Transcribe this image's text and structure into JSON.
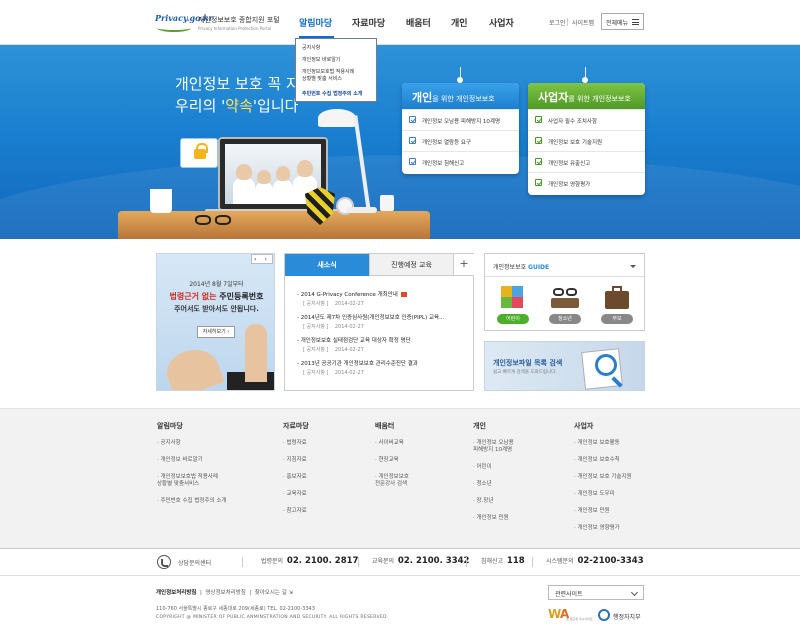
{
  "header": {
    "logo_text": "Privacy.go.kr",
    "site_title": "개인정보보호 종합지원 포털",
    "site_subtitle": "Privacy Information Protection Portal",
    "nav": [
      "알림마당",
      "자료마당",
      "배움터",
      "개인",
      "사업자"
    ],
    "util": {
      "login": "로그인",
      "sitemap": "사이트맵",
      "all_menu": "전체메뉴"
    }
  },
  "dropdown": {
    "items": [
      "공지사항",
      "개인정보 바로알기",
      "개인정보보호법 적용사례",
      "상황별 맞춤 서비스",
      "주민번호 수집 법정주의 소개"
    ]
  },
  "hero": {
    "line1": "개인정보 보호 꼭 지",
    "line2_prefix": "우리의 '",
    "line2_keyword": "약속",
    "line2_suffix": "'입니다"
  },
  "panels": {
    "personal": {
      "title_bold": "개인",
      "title_rest": "을 위한 개인정보보호",
      "items": [
        "개인정보 오남용 피해방지 10계명",
        "개인정보 열람등 요구",
        "개인정보 침해신고"
      ]
    },
    "business": {
      "title_bold": "사업자",
      "title_rest": "를 위한 개인정보보호",
      "items": [
        "사업자 필수 조치사항",
        "개인정보 보호 기술지원",
        "개인정보 유출신고",
        "개인정보 영향평가"
      ]
    }
  },
  "promo": {
    "nav": "‹ ›",
    "date": "2014년 8월 7일부터",
    "big_red": "법령근거 없는",
    "big_rest": " 주민등록번호",
    "sub": "주어서도 받아서도 안됩니다.",
    "button": "자세히보기 ›"
  },
  "news": {
    "tab_active": "새소식",
    "tab_inactive": "진행예정 교육",
    "plus": "+",
    "items": [
      {
        "title": "- 2014 G-Privacy Conference 개최안내",
        "category": "[ 공지사항 ]",
        "date": "2014-02-27"
      },
      {
        "title": "- 2014년도 제7차 인증심사원(개인정보보호 인증(PIPL) 교육...",
        "category": "[ 공지사항 ]",
        "date": "2014-02-27"
      },
      {
        "title": "- 개인정보보호 실태점검단 교육 대상자 확정 명단",
        "category": "[ 공지사항 ]",
        "date": "2014-02-27"
      },
      {
        "title": "- 2013년 공공기관 개인정보보호 관리수준진단 결과",
        "category": "[ 공지사항 ]",
        "date": "2014-02-27"
      }
    ]
  },
  "guide": {
    "title_prefix": "개인정보보호 ",
    "title_accent": "GUIDE",
    "buttons": [
      {
        "label": "어린이",
        "color": "#4caf2a",
        "icon": "puzzle-icon"
      },
      {
        "label": "청소년",
        "color": "#888888",
        "icon": "glasses-book-icon"
      },
      {
        "label": "부모",
        "color": "#888888",
        "icon": "briefcase-icon"
      }
    ]
  },
  "file_search": {
    "title": "개인정보파일 목록 검색",
    "subtitle": "쉽고 빠르게 검색을 도와드립니다."
  },
  "sitemap": {
    "columns": [
      {
        "title": "알림마당",
        "items": [
          "· 공지사항",
          "· 개인정보 바로알기",
          "· 개인정보보호법 적용사례\n상황별 맞춤서비스",
          "· 주민번호 수집 법정주의 소개"
        ]
      },
      {
        "title": "자료마당",
        "items": [
          "· 법령자료",
          "· 지침자료",
          "· 홍보자료",
          "· 교육자료",
          "· 참고자료"
        ]
      },
      {
        "title": "배움터",
        "items": [
          "· 사이버교육",
          "· 현장교육",
          "· 개인정보보호\n전문강사 검색"
        ]
      },
      {
        "title": "개인",
        "items": [
          "· 개인정보 오남용\n피해방지 10계명",
          "· 어린이",
          "· 청소년",
          "· 장.장년",
          "· 개인정보 민원"
        ]
      },
      {
        "title": "사업자",
        "items": [
          "· 개인정보 보호활동",
          "· 개인정보 보호수칙",
          "· 개인정보 보호 기술지원",
          "· 개인정보 도우미",
          "· 개인정보 민원",
          "· 개인정보 영향평가"
        ]
      }
    ]
  },
  "contact": {
    "center": "상담문의센터",
    "items": [
      {
        "label": "법령문의",
        "number": "02. 2100. 2817"
      },
      {
        "label": "교육문의",
        "number": "02. 2100. 3342"
      },
      {
        "label": "침해신고",
        "number": "118"
      },
      {
        "label": "시스템문의",
        "number": "02-2100-3343"
      }
    ]
  },
  "footer": {
    "links": [
      "개인정보처리방침",
      "영상정보처리방침",
      "찾아오시는 길"
    ],
    "address": "110-760 서울특별시 종로구 세종대로 209(세종로)  TEL. 02-2100-3343",
    "copyright": "COPYRIGHT @ MINISTER OF PUBLIC ANMINSTRATION AND SECURITY. ALL RIGHTS RESERVED.",
    "related_select": "관련사이트",
    "logo_wa_text": "웹 접근성 우수사이트",
    "logo_moi_text": "행정자치부"
  }
}
